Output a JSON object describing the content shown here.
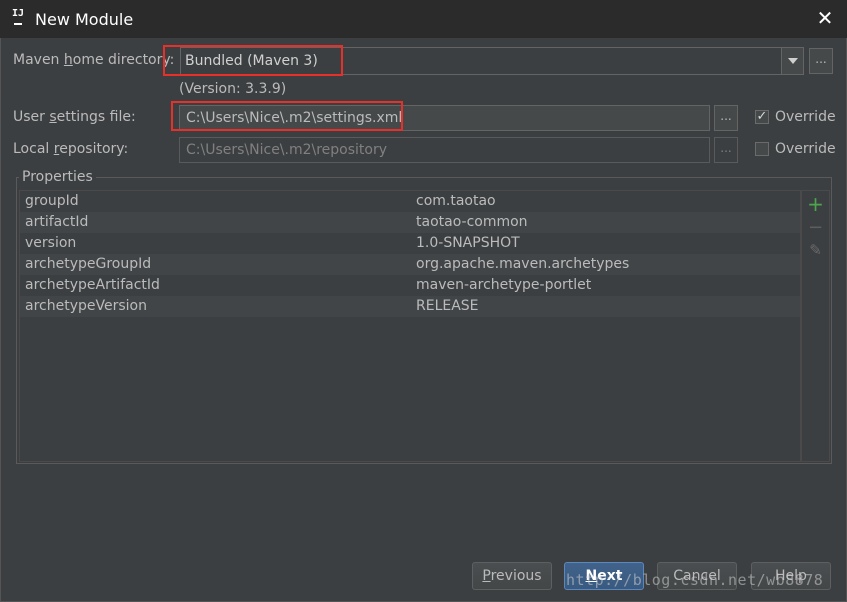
{
  "window": {
    "title": "New Module",
    "app_icon_text": "IJ",
    "close_glyph": "✕"
  },
  "maven_home": {
    "label_pre": "Maven ",
    "label_u": "h",
    "label_post": "ome directory:",
    "value": "Bundled (Maven 3)",
    "browse": "...",
    "version": "(Version: 3.3.9)"
  },
  "user_settings": {
    "label_pre": "User ",
    "label_u": "s",
    "label_post": "ettings file:",
    "value": "C:\\Users\\Nice\\.m2\\settings.xml",
    "browse": "...",
    "override_label": "Override",
    "override_checked": true,
    "check_glyph": "✓"
  },
  "local_repo": {
    "label_pre": "Local ",
    "label_u": "r",
    "label_post": "epository:",
    "value": "C:\\Users\\Nice\\.m2\\repository",
    "browse": "...",
    "override_label": "Override",
    "override_checked": false
  },
  "properties": {
    "title": "Properties",
    "rows": [
      {
        "key": "groupId",
        "value": "com.taotao"
      },
      {
        "key": "artifactId",
        "value": "taotao-common"
      },
      {
        "key": "version",
        "value": "1.0-SNAPSHOT"
      },
      {
        "key": "archetypeGroupId",
        "value": "org.apache.maven.archetypes"
      },
      {
        "key": "archetypeArtifactId",
        "value": "maven-archetype-portlet"
      },
      {
        "key": "archetypeVersion",
        "value": "RELEASE"
      }
    ],
    "toolbar": {
      "add": "+",
      "remove": "−",
      "edit": "✎"
    }
  },
  "buttons": {
    "previous_u": "P",
    "previous_rest": "revious",
    "next_u": "N",
    "next_rest": "ext",
    "cancel": "Cancel",
    "help": "Help"
  },
  "colors": {
    "accent": "#e8302a",
    "add_green": "#4ca64c",
    "primary_button": "#41628a"
  },
  "watermark": "http://blog.csdn.net/wb8878"
}
